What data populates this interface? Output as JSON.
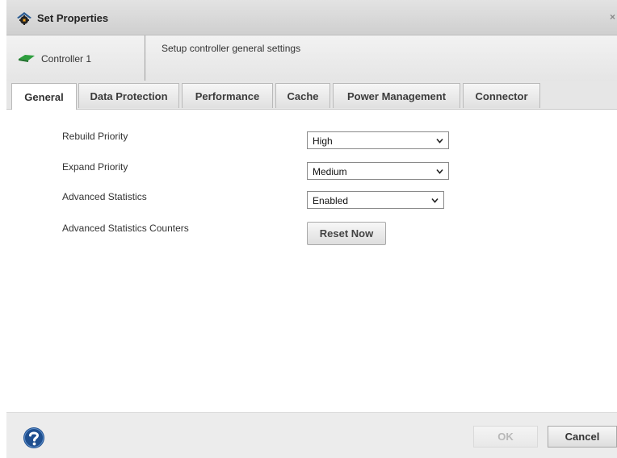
{
  "window": {
    "title": "Set Properties",
    "close_glyph": "×",
    "title_icon": "gear-home-icon"
  },
  "header": {
    "controller_label": "Controller 1",
    "controller_icon": "controller-card-icon",
    "description": "Setup controller general settings"
  },
  "tabs": [
    {
      "label": "General",
      "active": true
    },
    {
      "label": "Data Protection",
      "active": false
    },
    {
      "label": "Performance",
      "active": false
    },
    {
      "label": "Cache",
      "active": false
    },
    {
      "label": "Power Management",
      "active": false
    },
    {
      "label": "Connector",
      "active": false
    }
  ],
  "settings": {
    "rebuild_priority": {
      "label": "Rebuild Priority",
      "value": "High"
    },
    "expand_priority": {
      "label": "Expand Priority",
      "value": "Medium"
    },
    "advanced_statistics": {
      "label": "Advanced Statistics",
      "value": "Enabled"
    },
    "advanced_statistics_counters": {
      "label": "Advanced Statistics Counters",
      "button": "Reset Now"
    }
  },
  "footer": {
    "help_icon": "help-icon",
    "ok_label": "OK",
    "ok_enabled": false,
    "cancel_label": "Cancel"
  },
  "colors": {
    "titlebar": "#d9d9d9",
    "tab_bar": "#e6e6e6",
    "help_icon": "#1f4f8f",
    "controller_icon": "#2e9e3e"
  }
}
